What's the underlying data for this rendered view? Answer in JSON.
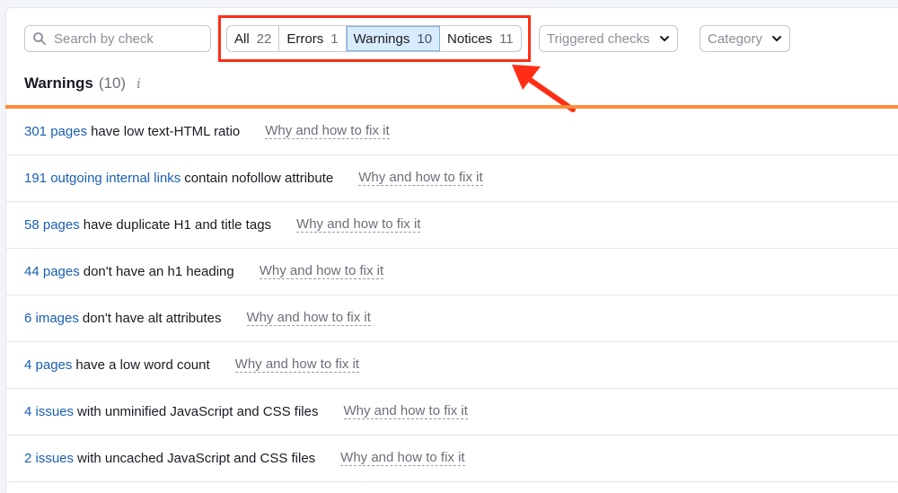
{
  "search": {
    "placeholder": "Search by check"
  },
  "filters": [
    {
      "label": "All",
      "count": "22"
    },
    {
      "label": "Errors",
      "count": "1"
    },
    {
      "label": "Warnings",
      "count": "10"
    },
    {
      "label": "Notices",
      "count": "11"
    }
  ],
  "triggered_checks": {
    "label": "Triggered checks"
  },
  "category": {
    "label": "Category"
  },
  "section": {
    "title": "Warnings",
    "count": "(10)",
    "info": "i"
  },
  "fix_label": "Why and how to fix it",
  "rows": [
    {
      "link": "301 pages",
      "text": "have low text-HTML ratio"
    },
    {
      "link": "191 outgoing internal links",
      "text": "contain nofollow attribute"
    },
    {
      "link": "58 pages",
      "text": "have duplicate H1 and title tags"
    },
    {
      "link": "44 pages",
      "text": "don't have an h1 heading"
    },
    {
      "link": "6 images",
      "text": "don't have alt attributes"
    },
    {
      "link": "4 pages",
      "text": "have a low word count"
    },
    {
      "link": "4 issues",
      "text": "with unminified JavaScript and CSS files"
    },
    {
      "link": "2 issues",
      "text": "with uncached JavaScript and CSS files"
    }
  ],
  "colors": {
    "accent_link": "#1a5fb4",
    "active_tab_bg": "#d8ebfd",
    "orange_divider": "#ff8c3a",
    "annotation_red": "#ff2d16"
  },
  "icons": {
    "search": "search-icon",
    "dropdown": "chevron-down-icon",
    "annotation": "arrow-icon"
  }
}
